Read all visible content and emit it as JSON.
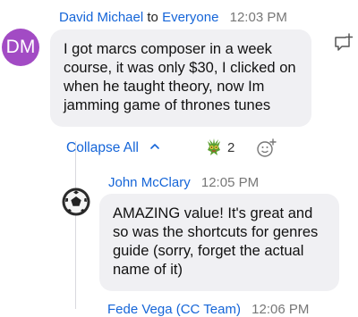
{
  "colors": {
    "avatar_dm": "#a24bc4",
    "link": "#1565d8"
  },
  "message1": {
    "avatar_initials": "DM",
    "sender": "David Michael",
    "to_label": "to",
    "recipient": "Everyone",
    "time": "12:03 PM",
    "body": "I got marcs composer in a week course, it was only $30, I clicked on when he taught theory, now Im jamming game of thrones tunes"
  },
  "thread": {
    "collapse_label": "Collapse All",
    "reaction_count": "2"
  },
  "message2": {
    "sender": "John McClary",
    "time": "12:05 PM",
    "body": "AMAZING value! It's great and so was the shortcuts for genres guide (sorry, forget the actual name of it)"
  },
  "message3": {
    "sender": "Fede Vega (CC Team)",
    "time": "12:06 PM"
  },
  "icons": {
    "add_reply": "comment-plus-icon",
    "collapse": "chevron-up-icon",
    "reaction": "dragon-emoji-icon",
    "add_reaction": "smiley-plus-icon",
    "john_avatar": "soccer-ball-icon"
  }
}
